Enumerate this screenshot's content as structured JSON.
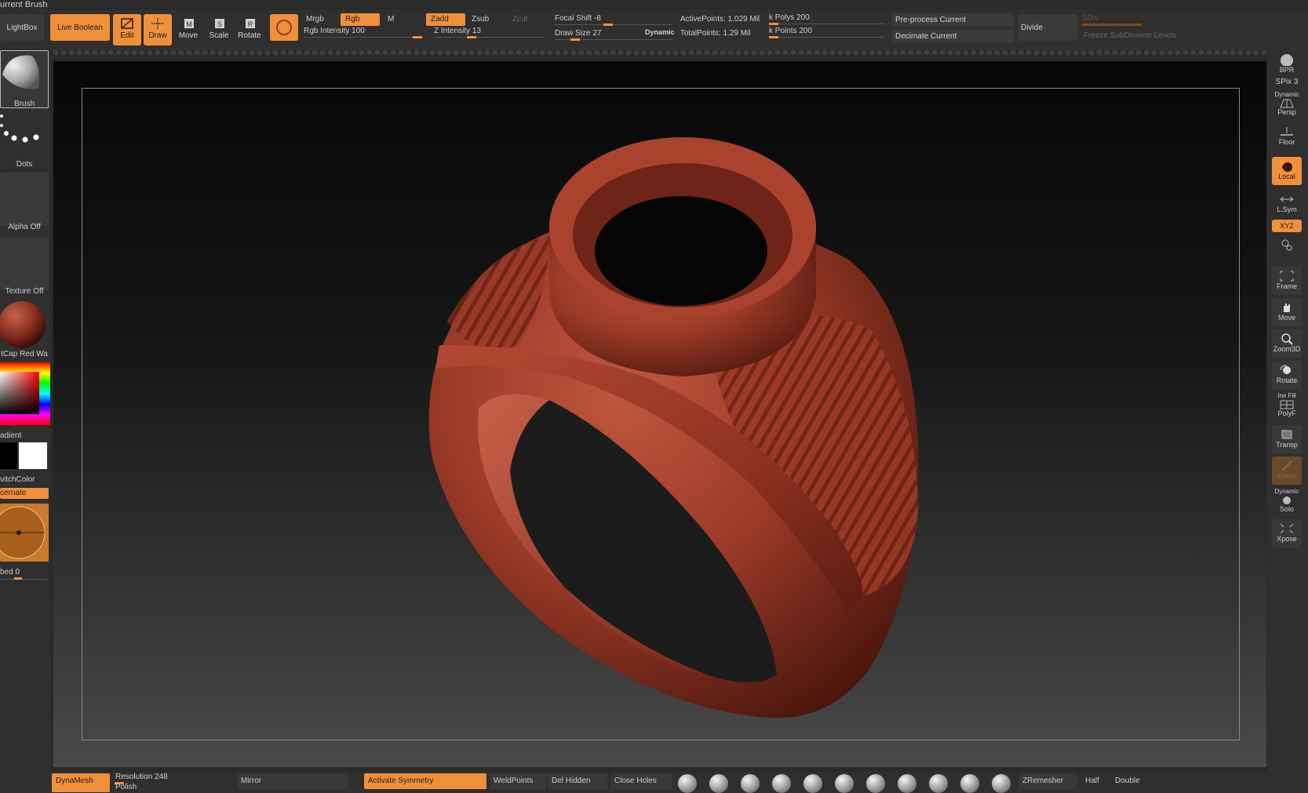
{
  "top": {
    "title": "urrent Brush",
    "lightbox": "LightBox",
    "live_boolean": "Live Boolean",
    "tools": {
      "edit": "Edit",
      "draw": "Draw",
      "move": "Move",
      "scale": "Scale",
      "rotate": "Rotate"
    },
    "mrgb": "Mrgb",
    "rgb": "Rgb",
    "m": "M",
    "zadd": "Zadd",
    "zsub": "Zsub",
    "zcut": "Zcut",
    "rgb_intensity": "Rgb Intensity 100",
    "z_intensity": "Z Intensity 13",
    "focal_shift": "Focal Shift -8",
    "draw_size": "Draw Size 27",
    "dynamic": "Dynamic",
    "active_points": "ActivePoints: 1.029 Mil",
    "total_points": "TotalPoints: 1.29 Mil",
    "k_polys": "k Polys 200",
    "k_points": "k Points 200",
    "preprocess": "Pre-process Current",
    "decimate": "Decimate Current",
    "divide": "Divide",
    "sdiv": "SDiv",
    "freeze": "Freeze SubDivision Levels"
  },
  "left": {
    "brush": "Brush",
    "dots": "Dots",
    "alpha": "Alpha Off",
    "texture": "Texture Off",
    "material": "tCap Red Wa",
    "gradient": "adient",
    "switch_color": "vitchColor",
    "alternate": "cernate",
    "embed": "bed 0"
  },
  "right": {
    "bpr": "BPR",
    "spix": "SPix 3",
    "dynamic": "Dynamic",
    "persp": "Persp",
    "floor": "Floor",
    "local": "Local",
    "lsym": "L.Sym",
    "xyz": "XYZ",
    "frame": "Frame",
    "move": "Move",
    "zoom3d": "Zoom3D",
    "rotate": "Rotate",
    "line_fill": "Ine Fill",
    "polyf": "PolyF",
    "transp": "Transp",
    "ghost": "Ghost",
    "dynamic2": "Dynamic",
    "solo": "Solo",
    "xpose": "Xpose"
  },
  "bottom": {
    "dynamesh": "DynaMesh",
    "resolution": "Resolution 248",
    "polish": "Polish",
    "mirror": "Mirror",
    "activate_symmetry": "Activate Symmetry",
    "weldpoints": "WeldPoints",
    "del_hidden": "Del Hidden",
    "close_holes": "Close Holes",
    "zremesher": "ZRemesher",
    "half": "Half",
    "double": "Double"
  },
  "colors": {
    "accent": "#f0903a",
    "ring": "#9a3a28",
    "panel": "#2f2f2f"
  },
  "values": {
    "rgb_intensity": 100,
    "z_intensity": 13,
    "focal_shift": -8,
    "draw_size": 27,
    "resolution": 248,
    "spix": 3
  }
}
